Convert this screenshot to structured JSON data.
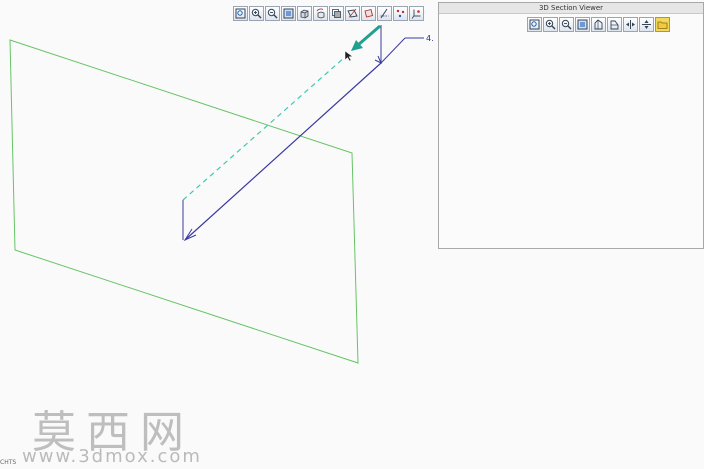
{
  "main_toolbar": {
    "buttons": [
      {
        "name": "zoom-fit-button",
        "icon": "zoom-fit-icon"
      },
      {
        "name": "zoom-in-button",
        "icon": "zoom-in-icon"
      },
      {
        "name": "zoom-out-button",
        "icon": "zoom-out-icon"
      },
      {
        "name": "zoom-window-button",
        "icon": "zoom-window-icon"
      },
      {
        "name": "shaded-view-button",
        "icon": "cube-icon"
      },
      {
        "name": "rotate-view-button",
        "icon": "rotate-cube-icon"
      },
      {
        "name": "layers-button",
        "icon": "layers-icon"
      },
      {
        "name": "datum-display-button",
        "icon": "datum-icon"
      },
      {
        "name": "plane-display-button",
        "icon": "plane-icon"
      },
      {
        "name": "axis-display-button",
        "icon": "axis-icon"
      },
      {
        "name": "point-display-button",
        "icon": "point-icon"
      },
      {
        "name": "csys-display-button",
        "icon": "csys-icon"
      }
    ]
  },
  "section_viewer": {
    "title": "3D Section Viewer",
    "buttons": [
      {
        "name": "viewer-refit-button",
        "icon": "zoom-fit-icon"
      },
      {
        "name": "viewer-zoom-in-button",
        "icon": "zoom-in-icon"
      },
      {
        "name": "viewer-zoom-out-button",
        "icon": "zoom-out-icon"
      },
      {
        "name": "viewer-zoom-window-button",
        "icon": "zoom-window-icon"
      },
      {
        "name": "viewer-rotate-left-button",
        "icon": "rotate-left-icon"
      },
      {
        "name": "viewer-rotate-right-button",
        "icon": "rotate-right-icon"
      },
      {
        "name": "viewer-flip-horizontal-button",
        "icon": "flip-horizontal-icon"
      },
      {
        "name": "viewer-flip-vertical-button",
        "icon": "flip-vertical-icon"
      },
      {
        "name": "viewer-options-button",
        "icon": "folder-icon"
      }
    ]
  },
  "model": {
    "dimension_label": "4.",
    "colors": {
      "datum_plane": "#66c466",
      "sketch_line": "#3a3aa0",
      "preview_line": "#40c8b0",
      "direction_arrow": "#20a090"
    }
  },
  "status_text": "CHTS",
  "watermark": {
    "chinese": "莫西网",
    "url": "www.3dmox.com"
  }
}
